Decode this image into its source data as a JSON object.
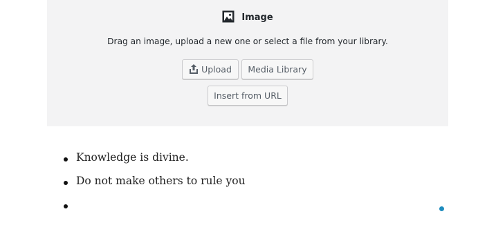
{
  "image_block": {
    "icon": "image-icon",
    "title": "Image",
    "instructions": "Drag an image, upload a new one or select a file from your library.",
    "buttons": {
      "upload": {
        "label": "Upload",
        "icon": "upload-icon"
      },
      "media_library": {
        "label": "Media Library"
      },
      "insert_url": {
        "label": "Insert from URL"
      }
    }
  },
  "list": {
    "items": [
      "Knowledge is divine.",
      "Do not make others to rule you",
      ""
    ]
  },
  "colors": {
    "block_background": "#f3f3f4",
    "accent": "#1e8cbe"
  }
}
